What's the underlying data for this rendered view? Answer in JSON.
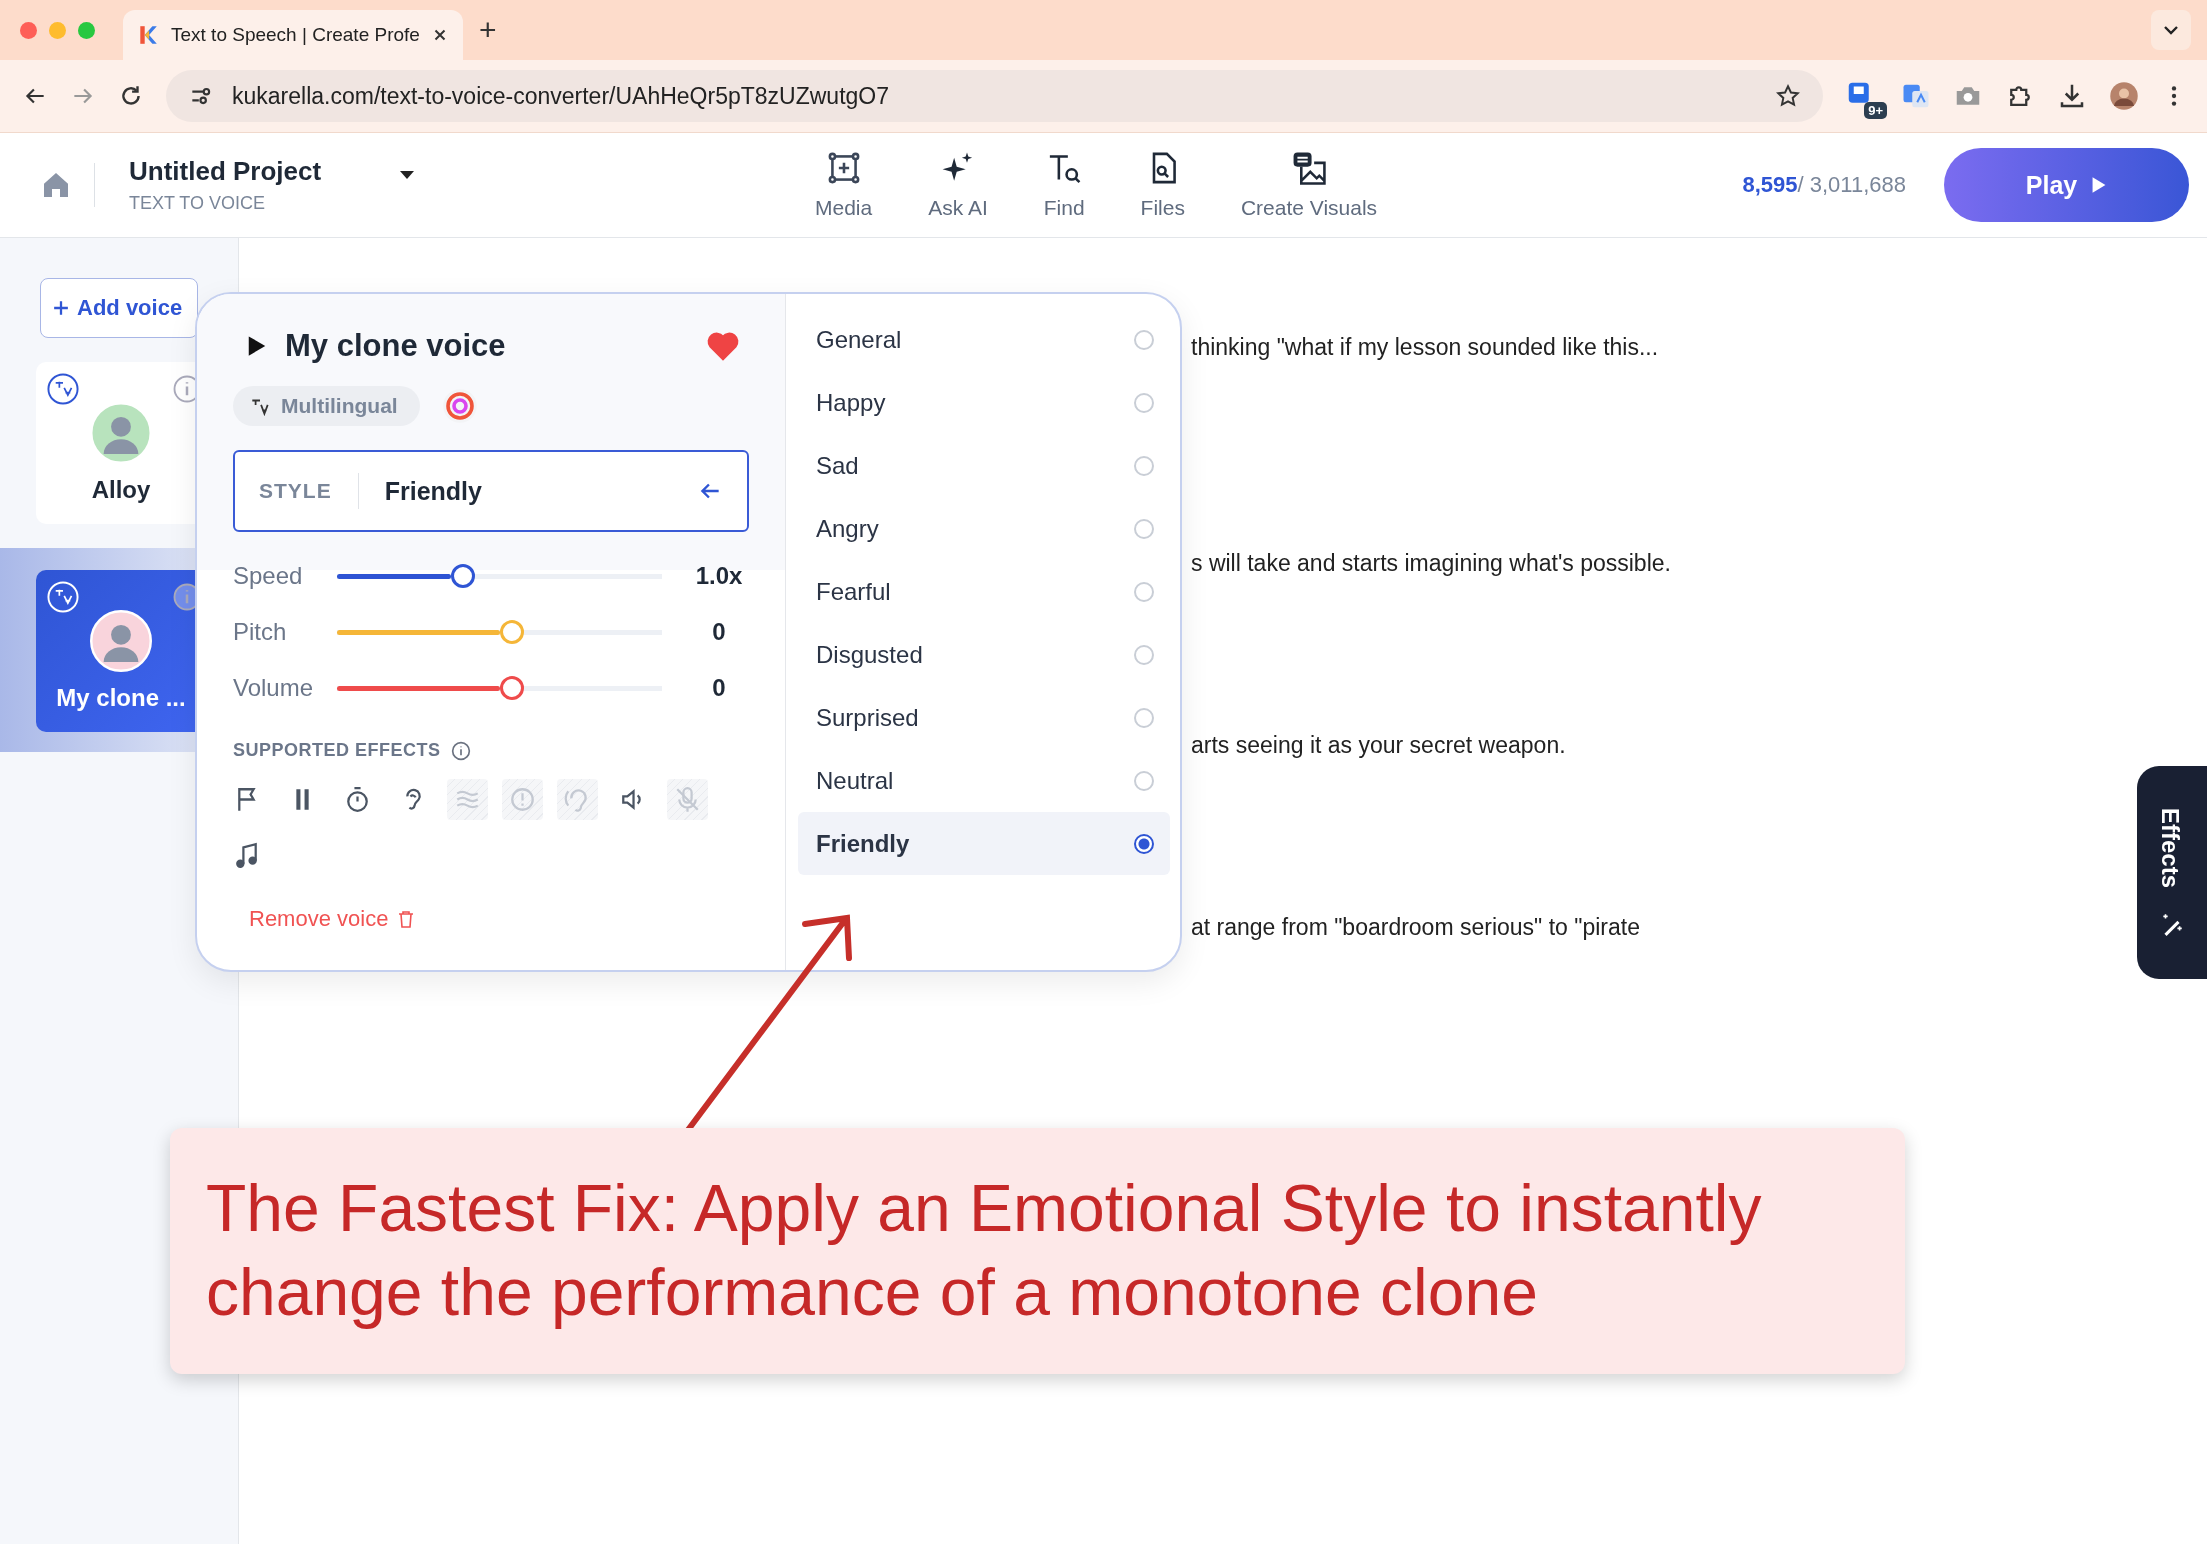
{
  "browser": {
    "tab_title": "Text to Speech | Create Profe",
    "new_tab": "+",
    "url": "kukarella.com/text-to-voice-converter/UAhHeQr5pT8zUZwutgO7",
    "extension_badge": "9+"
  },
  "header": {
    "project_title": "Untitled Project",
    "project_subtitle": "TEXT TO VOICE",
    "nav": [
      {
        "kind": "media",
        "label": "Media"
      },
      {
        "kind": "ai",
        "label": "Ask AI"
      },
      {
        "kind": "find",
        "label": "Find"
      },
      {
        "kind": "files",
        "label": "Files"
      },
      {
        "kind": "visuals",
        "label": "Create Visuals"
      }
    ],
    "used": "8,595",
    "total": "/ 3,011,688",
    "play": "Play"
  },
  "sidebar": {
    "add_voice": "Add voice",
    "voices": [
      {
        "name": "Alloy",
        "selected": false
      },
      {
        "name": "My clone ...",
        "selected": true
      }
    ]
  },
  "voice_panel": {
    "title": "My clone voice",
    "favorite": true,
    "tag": "Multilingual",
    "style_label": "STYLE",
    "style_value": "Friendly",
    "sliders": [
      {
        "label": "Speed",
        "level": 0.35,
        "reading": "1.0x",
        "color": "#2f55d4"
      },
      {
        "label": "Pitch",
        "level": 0.5,
        "reading": "0",
        "color": "#f5b638"
      },
      {
        "label": "Volume",
        "level": 0.5,
        "reading": "0",
        "color": "#ef4b4b"
      }
    ],
    "effects_label": "SUPPORTED EFFECTS",
    "effects": [
      {
        "kind": "flag",
        "disabled": false
      },
      {
        "kind": "pause",
        "disabled": false
      },
      {
        "kind": "timer",
        "disabled": false
      },
      {
        "kind": "ear",
        "disabled": false
      },
      {
        "kind": "waves",
        "disabled": true
      },
      {
        "kind": "alert",
        "disabled": true
      },
      {
        "kind": "hearing",
        "disabled": true
      },
      {
        "kind": "speaker",
        "disabled": false
      },
      {
        "kind": "mic-off",
        "disabled": true
      },
      {
        "kind": "music",
        "disabled": false
      }
    ],
    "remove": "Remove voice"
  },
  "styles": [
    {
      "label": "General",
      "selected": false
    },
    {
      "label": "Happy",
      "selected": false
    },
    {
      "label": "Sad",
      "selected": false
    },
    {
      "label": "Angry",
      "selected": false
    },
    {
      "label": "Fearful",
      "selected": false
    },
    {
      "label": "Disgusted",
      "selected": false
    },
    {
      "label": "Surprised",
      "selected": false
    },
    {
      "label": "Neutral",
      "selected": false
    },
    {
      "label": "Friendly",
      "selected": true
    }
  ],
  "script_lines": [
    "thinking \"what if my lesson sounded like this...",
    "s will take and starts imagining what's possible.",
    "arts seeing it as your secret weapon.",
    "at range from \"boardroom serious\" to \"pirate"
  ],
  "effects_tab": "Effects",
  "annotation": "The Fastest Fix: Apply an Emotional Style to instantly change the performance of a monotone clone"
}
